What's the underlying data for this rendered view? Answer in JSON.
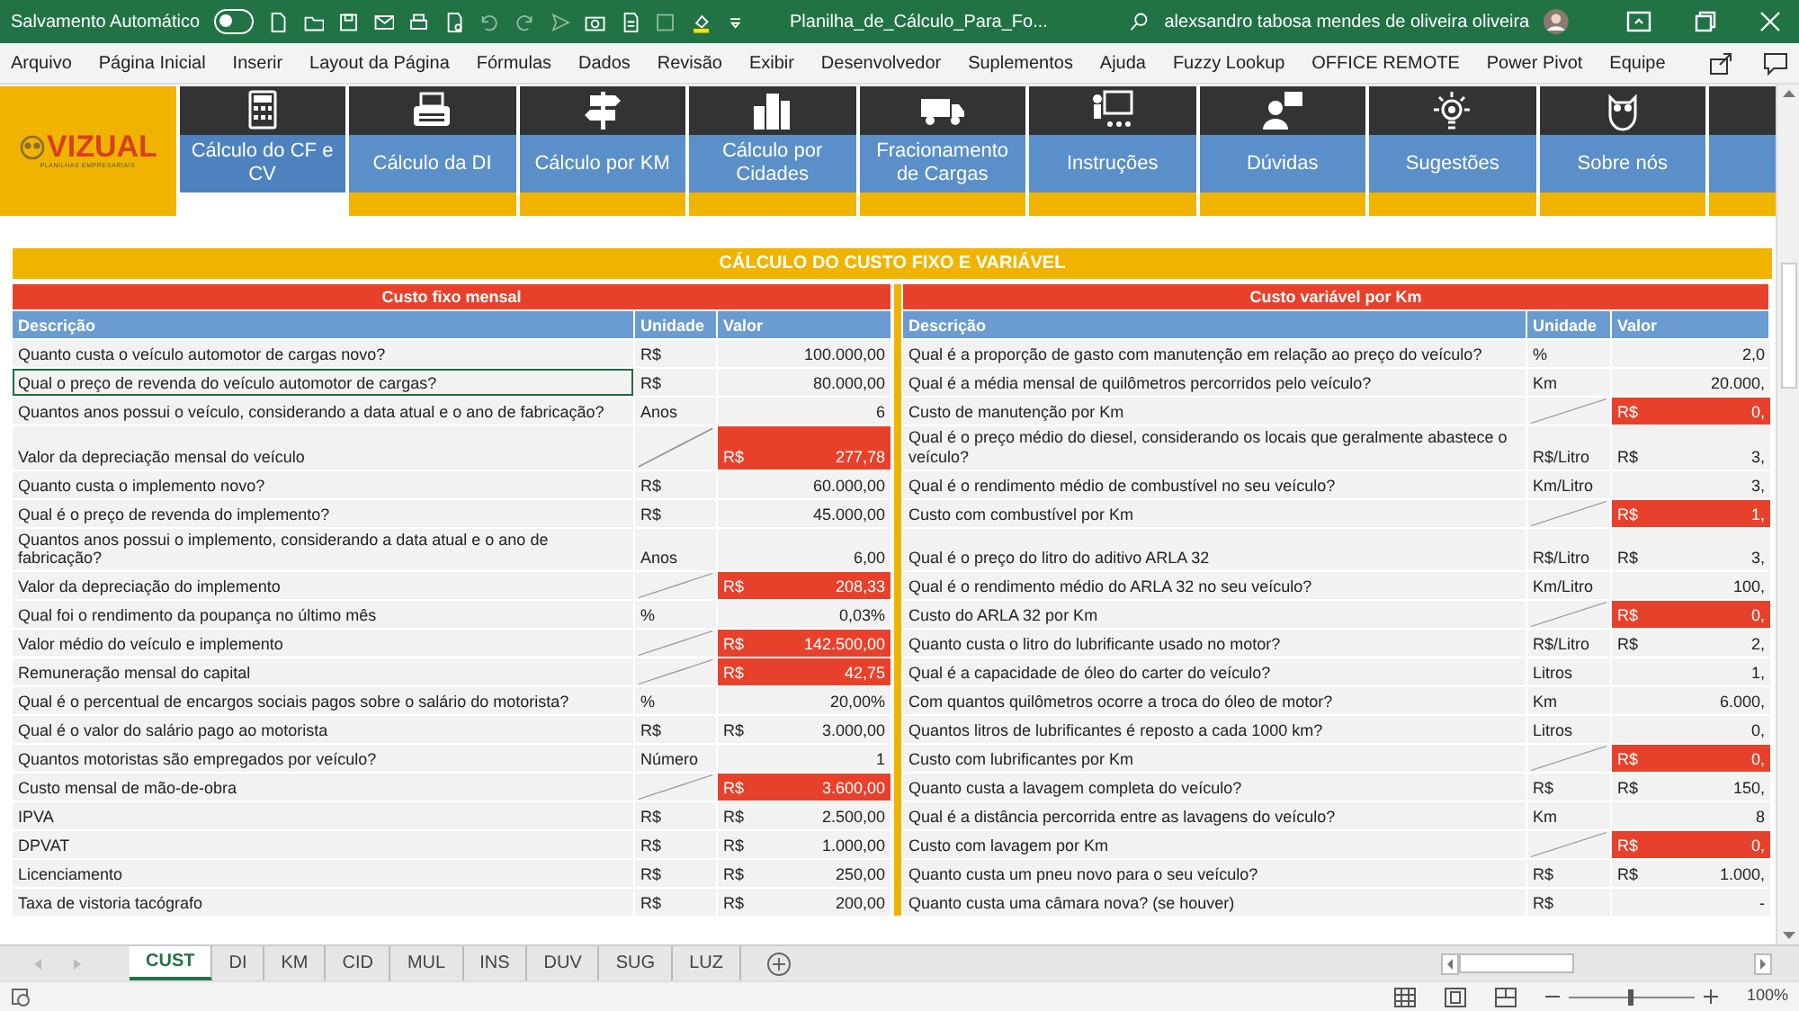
{
  "title_bar": {
    "autosave_label": "Salvamento Automático",
    "autosave_on": false,
    "filename": "Planilha_de_Cálculo_Para_Fo...",
    "user": "alexsandro tabosa mendes de oliveira oliveira"
  },
  "menu": [
    "Arquivo",
    "Página Inicial",
    "Inserir",
    "Layout da Página",
    "Fórmulas",
    "Dados",
    "Revisão",
    "Exibir",
    "Desenvolvedor",
    "Suplementos",
    "Ajuda",
    "Fuzzy Lookup",
    "OFFICE REMOTE",
    "Power Pivot",
    "Equipe"
  ],
  "logo": {
    "name": "VIZUAL",
    "tagline": "PLANILHAS EMPRESARIAIS"
  },
  "nav_tabs": [
    {
      "label": "Cálculo do CF e CV",
      "selected": true
    },
    {
      "label": "Cálculo da DI",
      "selected": false
    },
    {
      "label": "Cálculo por KM",
      "selected": false
    },
    {
      "label": "Cálculo por Cidades",
      "selected": false
    },
    {
      "label": "Fracionamento de Cargas",
      "selected": false
    },
    {
      "label": "Instruções",
      "selected": false
    },
    {
      "label": "Dúvidas",
      "selected": false
    },
    {
      "label": "Sugestões",
      "selected": false
    },
    {
      "label": "Sobre nós",
      "selected": false
    }
  ],
  "sheet_title": "CÁLCULO DO CUSTO FIXO E VARIÁVEL",
  "tables": [
    {
      "title": "Custo fixo mensal",
      "columns": [
        "Descrição",
        "Unidade",
        "Valor"
      ],
      "rows": [
        {
          "description": "Quanto custa o veículo automotor de cargas novo?",
          "unit": "R$",
          "value": "100.000,00",
          "kind": "input",
          "selected": false
        },
        {
          "description": "Qual o preço de revenda do veículo automotor de cargas?",
          "unit": "R$",
          "value": "80.000,00",
          "kind": "input",
          "selected": true
        },
        {
          "description": "Quantos anos possui o veículo, considerando a data atual e o ano de fabricação?",
          "unit": "Anos",
          "value": "6",
          "kind": "input",
          "selected": false
        },
        {
          "description": "Valor da depreciação mensal do veículo",
          "currency": "R$",
          "value": "277,78",
          "kind": "calc",
          "selected": false
        },
        {
          "description": "Quanto custa o implemento novo?",
          "unit": "R$",
          "value": "60.000,00",
          "kind": "input",
          "selected": false
        },
        {
          "description": "Qual é o preço de revenda do implemento?",
          "unit": "R$",
          "value": "45.000,00",
          "kind": "input",
          "selected": false
        },
        {
          "description": "Quantos anos possui o implemento, considerando a data atual e o ano de fabricação?",
          "unit": "Anos",
          "value": "6,00",
          "kind": "input",
          "selected": false
        },
        {
          "description": "Valor da depreciação do implemento",
          "currency": "R$",
          "value": "208,33",
          "kind": "calc",
          "selected": false
        },
        {
          "description": "Qual foi o rendimento da poupança no último mês",
          "unit": "%",
          "value": "0,03%",
          "kind": "input",
          "selected": false
        },
        {
          "description": "Valor médio do veículo e implemento",
          "currency": "R$",
          "value": "142.500,00",
          "kind": "calc",
          "selected": false
        },
        {
          "description": "Remuneração mensal do capital",
          "currency": "R$",
          "value": "42,75",
          "kind": "calc",
          "selected": false
        },
        {
          "description": "Qual é o percentual de encargos sociais pagos sobre o salário do motorista?",
          "unit": "%",
          "value": "20,00%",
          "kind": "input",
          "selected": false
        },
        {
          "description": "Qual é o valor do salário pago ao motorista",
          "unit": "R$",
          "currency": "R$",
          "value": "3.000,00",
          "kind": "input",
          "selected": false
        },
        {
          "description": "Quantos motoristas são empregados por veículo?",
          "unit": "Número",
          "value": "1",
          "kind": "input",
          "selected": false
        },
        {
          "description": "Custo mensal de mão-de-obra",
          "currency": "R$",
          "value": "3.600,00",
          "kind": "calc",
          "selected": false
        },
        {
          "description": "IPVA",
          "unit": "R$",
          "currency": "R$",
          "value": "2.500,00",
          "kind": "input",
          "selected": false
        },
        {
          "description": "DPVAT",
          "unit": "R$",
          "currency": "R$",
          "value": "1.000,00",
          "kind": "input",
          "selected": false
        },
        {
          "description": "Licenciamento",
          "unit": "R$",
          "currency": "R$",
          "value": "250,00",
          "kind": "input",
          "selected": false
        },
        {
          "description": "Taxa de vistoria tacógrafo",
          "unit": "R$",
          "currency": "R$",
          "value": "200,00",
          "kind": "input",
          "selected": false
        }
      ]
    },
    {
      "title": "Custo variável por Km",
      "columns": [
        "Descrição",
        "Unidade",
        "Valor"
      ],
      "rows": [
        {
          "description": "Qual é a proporção de gasto com manutenção em relação ao preço do veículo?",
          "unit": "%",
          "value": "2,0",
          "kind": "input",
          "selected": false
        },
        {
          "description": "Qual é a média mensal de quilômetros percorridos pelo veículo?",
          "unit": "Km",
          "value": "20.000,",
          "kind": "input",
          "selected": false
        },
        {
          "description": "Custo de manutenção por Km",
          "currency": "R$",
          "value": "0,",
          "kind": "calc",
          "selected": false
        },
        {
          "description": "Qual é o preço médio do diesel, considerando os locais que geralmente abastece o veículo?",
          "unit": "R$/Litro",
          "currency": "R$",
          "value": "3,",
          "kind": "input",
          "selected": false
        },
        {
          "description": "Qual é o rendimento médio de combustível no seu veículo?",
          "unit": "Km/Litro",
          "value": "3,",
          "kind": "input",
          "selected": false
        },
        {
          "description": "Custo com combustível por Km",
          "currency": "R$",
          "value": "1,",
          "kind": "calc",
          "selected": false
        },
        {
          "description": "Qual é o preço do litro do aditivo ARLA 32",
          "unit": "R$/Litro",
          "currency": "R$",
          "value": "3,",
          "kind": "input",
          "selected": false
        },
        {
          "description": "Qual é o rendimento médio do ARLA 32 no seu veículo?",
          "unit": "Km/Litro",
          "value": "100,",
          "kind": "input",
          "selected": false
        },
        {
          "description": "Custo do ARLA 32 por Km",
          "currency": "R$",
          "value": "0,",
          "kind": "calc",
          "selected": false
        },
        {
          "description": "Quanto custa o litro do lubrificante usado no motor?",
          "unit": "R$/Litro",
          "currency": "R$",
          "value": "2,",
          "kind": "input",
          "selected": false
        },
        {
          "description": "Qual é a capacidade de óleo do carter do veículo?",
          "unit": "Litros",
          "value": "1,",
          "kind": "input",
          "selected": false
        },
        {
          "description": "Com quantos quilômetros ocorre a troca do óleo de motor?",
          "unit": "Km",
          "value": "6.000,",
          "kind": "input",
          "selected": false
        },
        {
          "description": "Quantos litros de lubrificantes é reposto a cada 1000 km?",
          "unit": "Litros",
          "value": "0,",
          "kind": "input",
          "selected": false
        },
        {
          "description": "Custo com lubrificantes por Km",
          "currency": "R$",
          "value": "0,",
          "kind": "calc",
          "selected": false
        },
        {
          "description": "Quanto custa a lavagem completa do veículo?",
          "unit": "R$",
          "currency": "R$",
          "value": "150,",
          "kind": "input",
          "selected": false
        },
        {
          "description": "Qual é a distância percorrida entre as lavagens do veículo?",
          "unit": "Km",
          "value": "8",
          "kind": "input",
          "selected": false
        },
        {
          "description": "Custo com lavagem por Km",
          "currency": "R$",
          "value": "0,",
          "kind": "calc",
          "selected": false
        },
        {
          "description": "Quanto custa um pneu novo para o seu veículo?",
          "unit": "R$",
          "currency": "R$",
          "value": "1.000,",
          "kind": "input",
          "selected": false
        },
        {
          "description": "Quanto custa uma câmara nova? (se houver)",
          "unit": "R$",
          "value": "-",
          "kind": "input",
          "selected": false
        }
      ]
    }
  ],
  "sheet_tabs": [
    {
      "label": "CUST",
      "selected": true
    },
    {
      "label": "DI",
      "selected": false
    },
    {
      "label": "KM",
      "selected": false
    },
    {
      "label": "CID",
      "selected": false
    },
    {
      "label": "MUL",
      "selected": false
    },
    {
      "label": "INS",
      "selected": false
    },
    {
      "label": "DUV",
      "selected": false
    },
    {
      "label": "SUG",
      "selected": false
    },
    {
      "label": "LUZ",
      "selected": false
    }
  ],
  "zoom": {
    "level": 0.5,
    "reading": "100%"
  }
}
